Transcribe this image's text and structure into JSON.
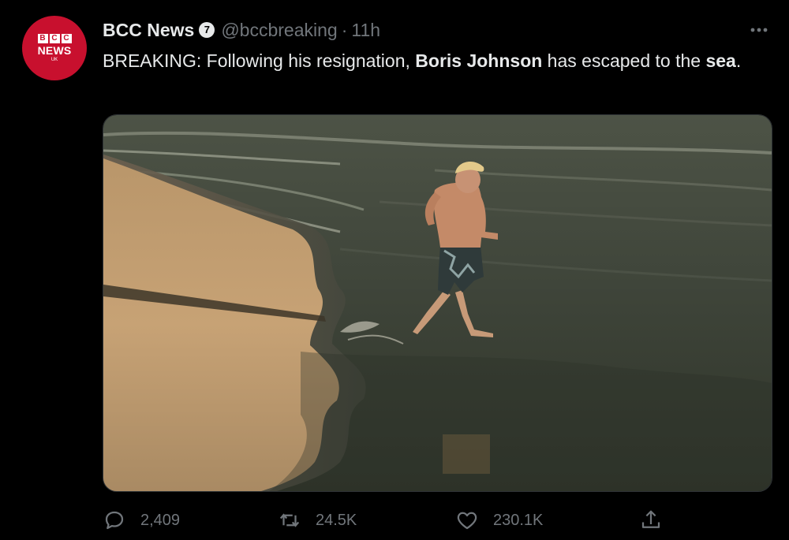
{
  "account": {
    "avatar_blocks": [
      "B",
      "C",
      "C"
    ],
    "avatar_news": "NEWS",
    "avatar_uk": "UK",
    "display_name": "BCC News",
    "verified_badge": "7",
    "handle": "@bccbreaking",
    "separator": "·",
    "timestamp": "11h"
  },
  "tweet": {
    "text_prefix": "BREAKING: Following his resignation, ",
    "text_bold_1": "Boris Johnson",
    "text_middle": " has escaped to the ",
    "text_bold_2": "sea",
    "text_suffix": "."
  },
  "actions": {
    "reply_count": "2,409",
    "retweet_count": "24.5K",
    "like_count": "230.1K"
  },
  "icons": {
    "more": "more-horizontal-icon",
    "reply": "reply-icon",
    "retweet": "retweet-icon",
    "like": "heart-icon",
    "share": "share-icon",
    "verified": "verified-badge-icon"
  },
  "colors": {
    "background": "#000000",
    "text": "#e7e9ea",
    "secondary_text": "#71767b",
    "avatar_red": "#c8102e"
  }
}
